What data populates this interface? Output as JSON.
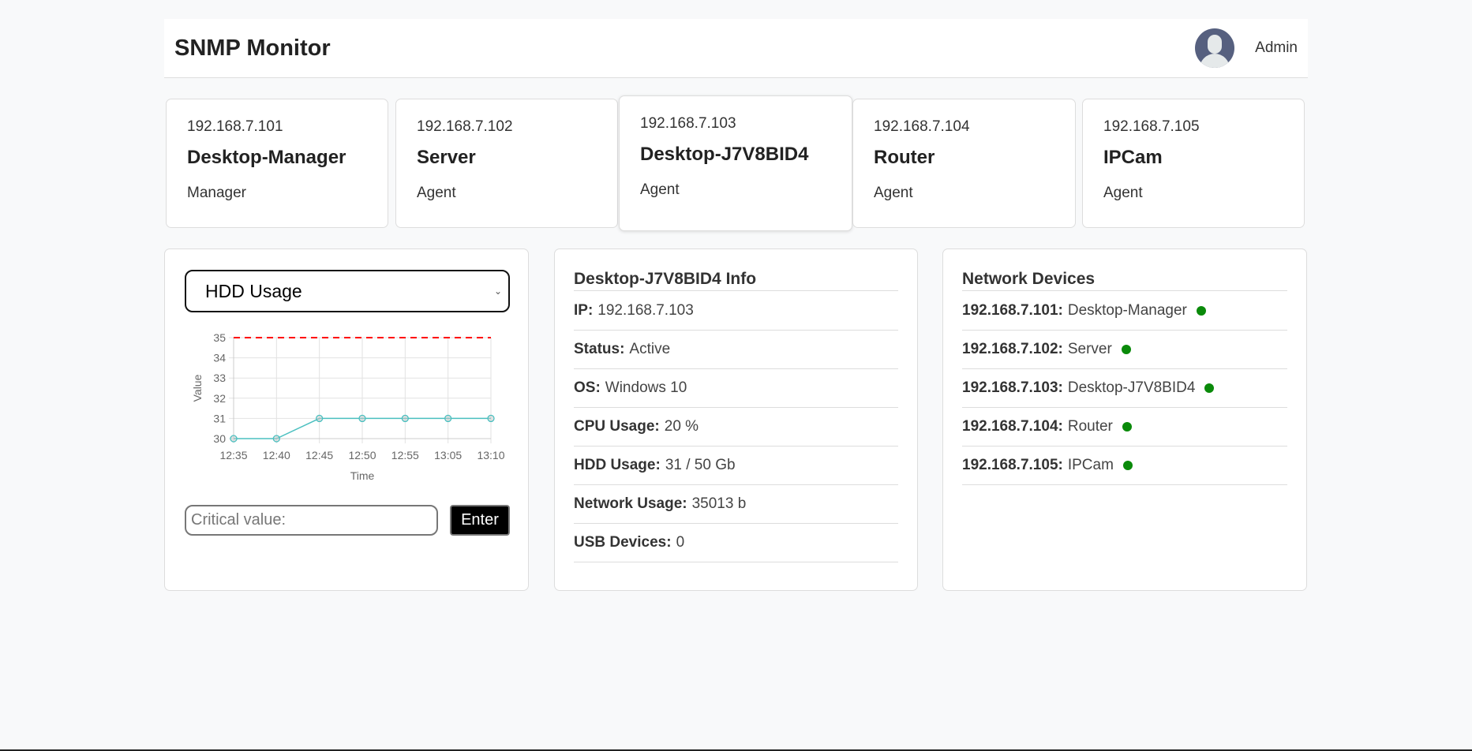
{
  "header": {
    "title": "SNMP Monitor",
    "user": "Admin"
  },
  "devices": [
    {
      "ip": "192.168.7.101",
      "name": "Desktop-Manager",
      "role": "Manager"
    },
    {
      "ip": "192.168.7.102",
      "name": "Server",
      "role": "Agent"
    },
    {
      "ip": "192.168.7.103",
      "name": "Desktop-J7V8BID4",
      "role": "Agent"
    },
    {
      "ip": "192.168.7.104",
      "name": "Router",
      "role": "Agent"
    },
    {
      "ip": "192.168.7.105",
      "name": "IPCam",
      "role": "Agent"
    }
  ],
  "chart_panel": {
    "metric": "HDD Usage",
    "critical_placeholder": "Critical value:",
    "enter_label": "Enter"
  },
  "chart_data": {
    "type": "line",
    "x": [
      "12:35",
      "12:40",
      "12:45",
      "12:50",
      "12:55",
      "13:05",
      "13:10"
    ],
    "series": [
      {
        "name": "HDD Usage",
        "values": [
          30,
          30,
          31,
          31,
          31,
          31,
          31
        ],
        "color": "#4bc0c0"
      }
    ],
    "threshold": {
      "value": 35,
      "color": "#ff0000"
    },
    "xlabel": "Time",
    "ylabel": "Value",
    "ylim": [
      30,
      35
    ],
    "yticks": [
      "30",
      "31",
      "32",
      "33",
      "34",
      "35"
    ],
    "grid": true
  },
  "info": {
    "title": "Desktop-J7V8BID4 Info",
    "rows": [
      {
        "label": "IP:",
        "value": "192.168.7.103"
      },
      {
        "label": "Status:",
        "value": "Active"
      },
      {
        "label": "OS:",
        "value": "Windows 10"
      },
      {
        "label": "CPU Usage:",
        "value": "20 %"
      },
      {
        "label": "HDD Usage:",
        "value": "31 / 50 Gb"
      },
      {
        "label": "Network Usage:",
        "value": "35013 b"
      },
      {
        "label": "USB Devices:",
        "value": "0"
      }
    ]
  },
  "network": {
    "title": "Network Devices",
    "status_color": "#0a8a0a",
    "items": [
      {
        "ip": "192.168.7.101:",
        "name": "Desktop-Manager"
      },
      {
        "ip": "192.168.7.102:",
        "name": "Server"
      },
      {
        "ip": "192.168.7.103:",
        "name": "Desktop-J7V8BID4"
      },
      {
        "ip": "192.168.7.104:",
        "name": "Router"
      },
      {
        "ip": "192.168.7.105:",
        "name": "IPCam"
      }
    ]
  }
}
